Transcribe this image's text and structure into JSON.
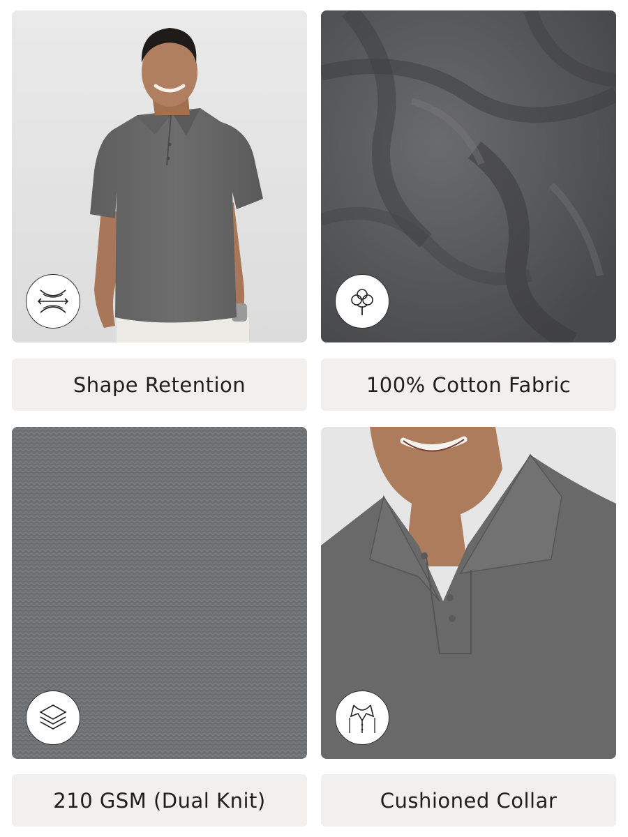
{
  "features": [
    {
      "label": "Shape Retention",
      "icon": "stretch-arrows-icon",
      "image": "model-wearing-grey-polo"
    },
    {
      "label": "100% Cotton Fabric",
      "icon": "cotton-flower-icon",
      "image": "grey-fabric-folds"
    },
    {
      "label": "210 GSM (Dual Knit)",
      "icon": "layers-icon",
      "image": "grey-knit-texture"
    },
    {
      "label": "Cushioned Collar",
      "icon": "collar-icon",
      "image": "polo-collar-closeup"
    }
  ],
  "colors": {
    "shirt": "#6a6a6a",
    "fabric": "#5b5c5e",
    "knit": "#727476",
    "label_bg": "#f1f0ee"
  }
}
